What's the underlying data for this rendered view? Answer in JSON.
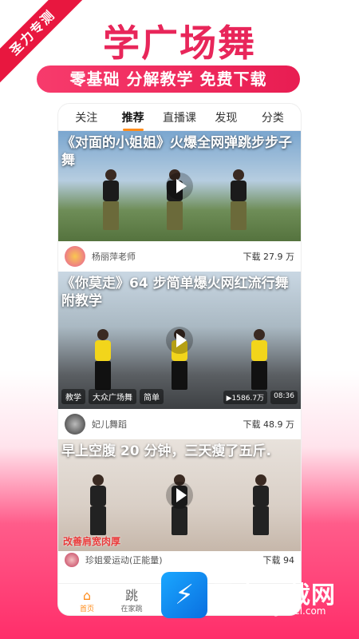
{
  "corner_badge": "圣力专测",
  "headline": "学广场舞",
  "subheadline": "零基础 分解教学 免费下载",
  "tabs": [
    "关注",
    "推荐",
    "直播课",
    "发现",
    "分类"
  ],
  "active_tab": "推荐",
  "feed": [
    {
      "title": "《对面的小姐姐》火爆全网弹跳步步子舞",
      "author": "杨丽萍老师",
      "download_label": "下载",
      "downloads": "27.9 万"
    },
    {
      "title": "《你莫走》64 步简单爆火网红流行舞附教学",
      "tags": [
        "教学",
        "大众广场舞",
        "简单"
      ],
      "plays": "▶1586.7万",
      "duration": "08:36",
      "author": "妃儿舞蹈",
      "download_label": "下载",
      "downloads": "48.9 万"
    },
    {
      "title": "早上空腹 20 分钟，三天瘦了五斤.",
      "overlay_text": "改善肩宽肉厚",
      "author": "珍姐爱运动(正能量)",
      "download_label": "下载",
      "downloads": "94"
    }
  ],
  "bottom_nav": [
    {
      "label": "首页",
      "icon": "home-icon"
    },
    {
      "label": "在家跳",
      "icon": "跳"
    }
  ],
  "watermark": {
    "title": "圣力下载网",
    "url": "www.hantongsteel.com"
  },
  "colors": {
    "brand_pink": "#e8265a",
    "accent_orange": "#ff8c1a",
    "ribbon_red": "#e8173f"
  }
}
